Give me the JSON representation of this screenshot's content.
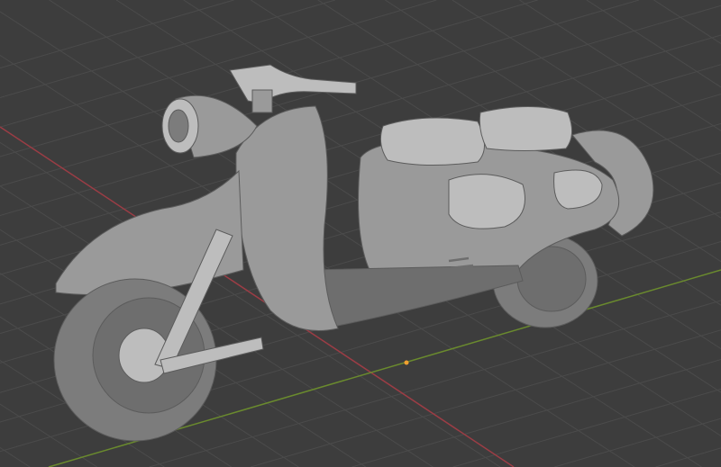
{
  "viewport": {
    "background_color": "#3d3d3d",
    "grid_color": "#4b4b4b",
    "x_axis_color": "#9b3d45",
    "y_axis_color": "#6a8a2e",
    "origin_color": "#f0a030",
    "model_color": "#9a9a9a",
    "model_shadow": "#6e6e6e",
    "model_highlight": "#bdbdbd"
  }
}
